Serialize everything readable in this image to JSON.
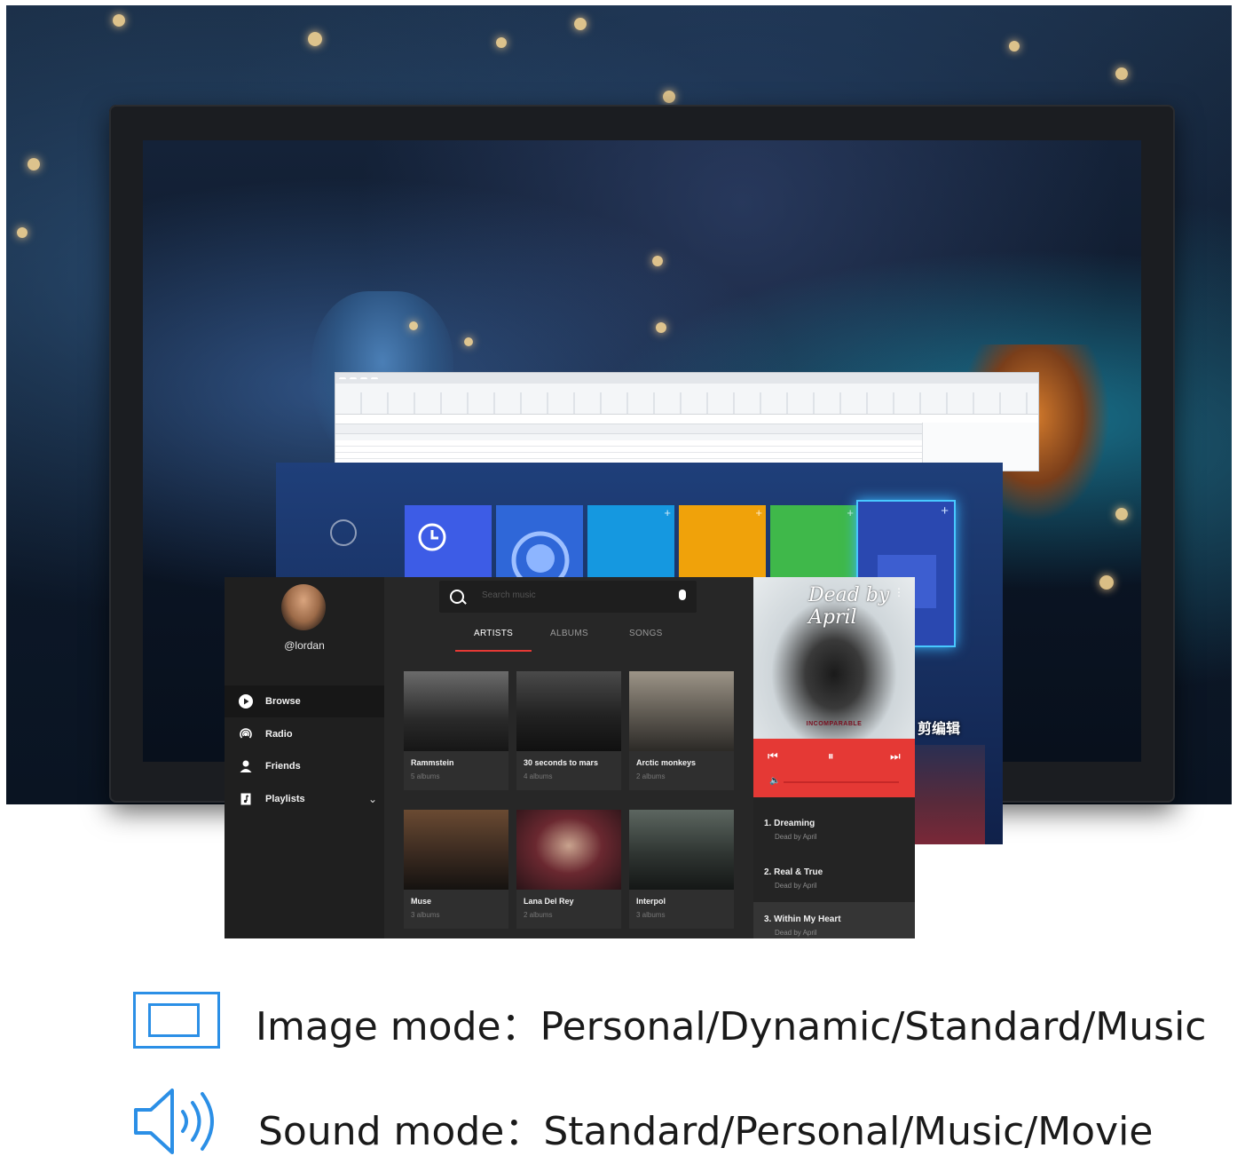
{
  "music_app": {
    "username": "@lordan",
    "nav": [
      {
        "label": "Browse",
        "icon": "play-circle-icon",
        "selected": true
      },
      {
        "label": "Radio",
        "icon": "radio-icon",
        "selected": false
      },
      {
        "label": "Friends",
        "icon": "person-icon",
        "selected": false
      },
      {
        "label": "Playlists",
        "icon": "playlist-icon",
        "selected": false
      }
    ],
    "search_placeholder": "Search music",
    "tabs": [
      "ARTISTS",
      "ALBUMS",
      "SONGS"
    ],
    "active_tab": "ARTISTS",
    "artists": [
      {
        "name": "Rammstein",
        "albums": "5 albums"
      },
      {
        "name": "30 seconds to mars",
        "albums": "4 albums"
      },
      {
        "name": "Arctic monkeys",
        "albums": "2 albums"
      },
      {
        "name": "Muse",
        "albums": "3 albums"
      },
      {
        "name": "Lana Del Rey",
        "albums": "2 albums"
      },
      {
        "name": "Interpol",
        "albums": "3 albums"
      }
    ],
    "album_cover": {
      "title": "Dead by April",
      "subtitle": "INCOMPARABLE"
    },
    "tracks": [
      {
        "title": "1. Dreaming",
        "artist": "Dead by April"
      },
      {
        "title": "2. Real & True",
        "artist": "Dead by April"
      },
      {
        "title": "3. Within My Heart",
        "artist": "Dead by April",
        "selected": true
      }
    ],
    "accent_color": "#e53935"
  },
  "metro": {
    "cjk_text": "剪编辑"
  },
  "captions": {
    "image_mode": "Image mode：Personal/Dynamic/Standard/Music",
    "sound_mode": "Sound mode：Standard/Personal/Music/Movie",
    "icon_color": "#2b8fe6"
  }
}
